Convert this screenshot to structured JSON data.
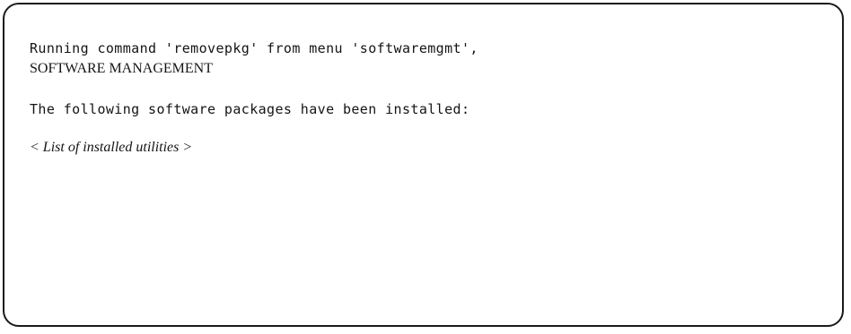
{
  "screen": {
    "command_line": "Running command 'removepkg' from menu 'softwaremgmt',",
    "menu_title": "SOFTWARE MANAGEMENT",
    "message": "The following software packages have been installed:",
    "placeholder": "< List of installed utilities >"
  }
}
